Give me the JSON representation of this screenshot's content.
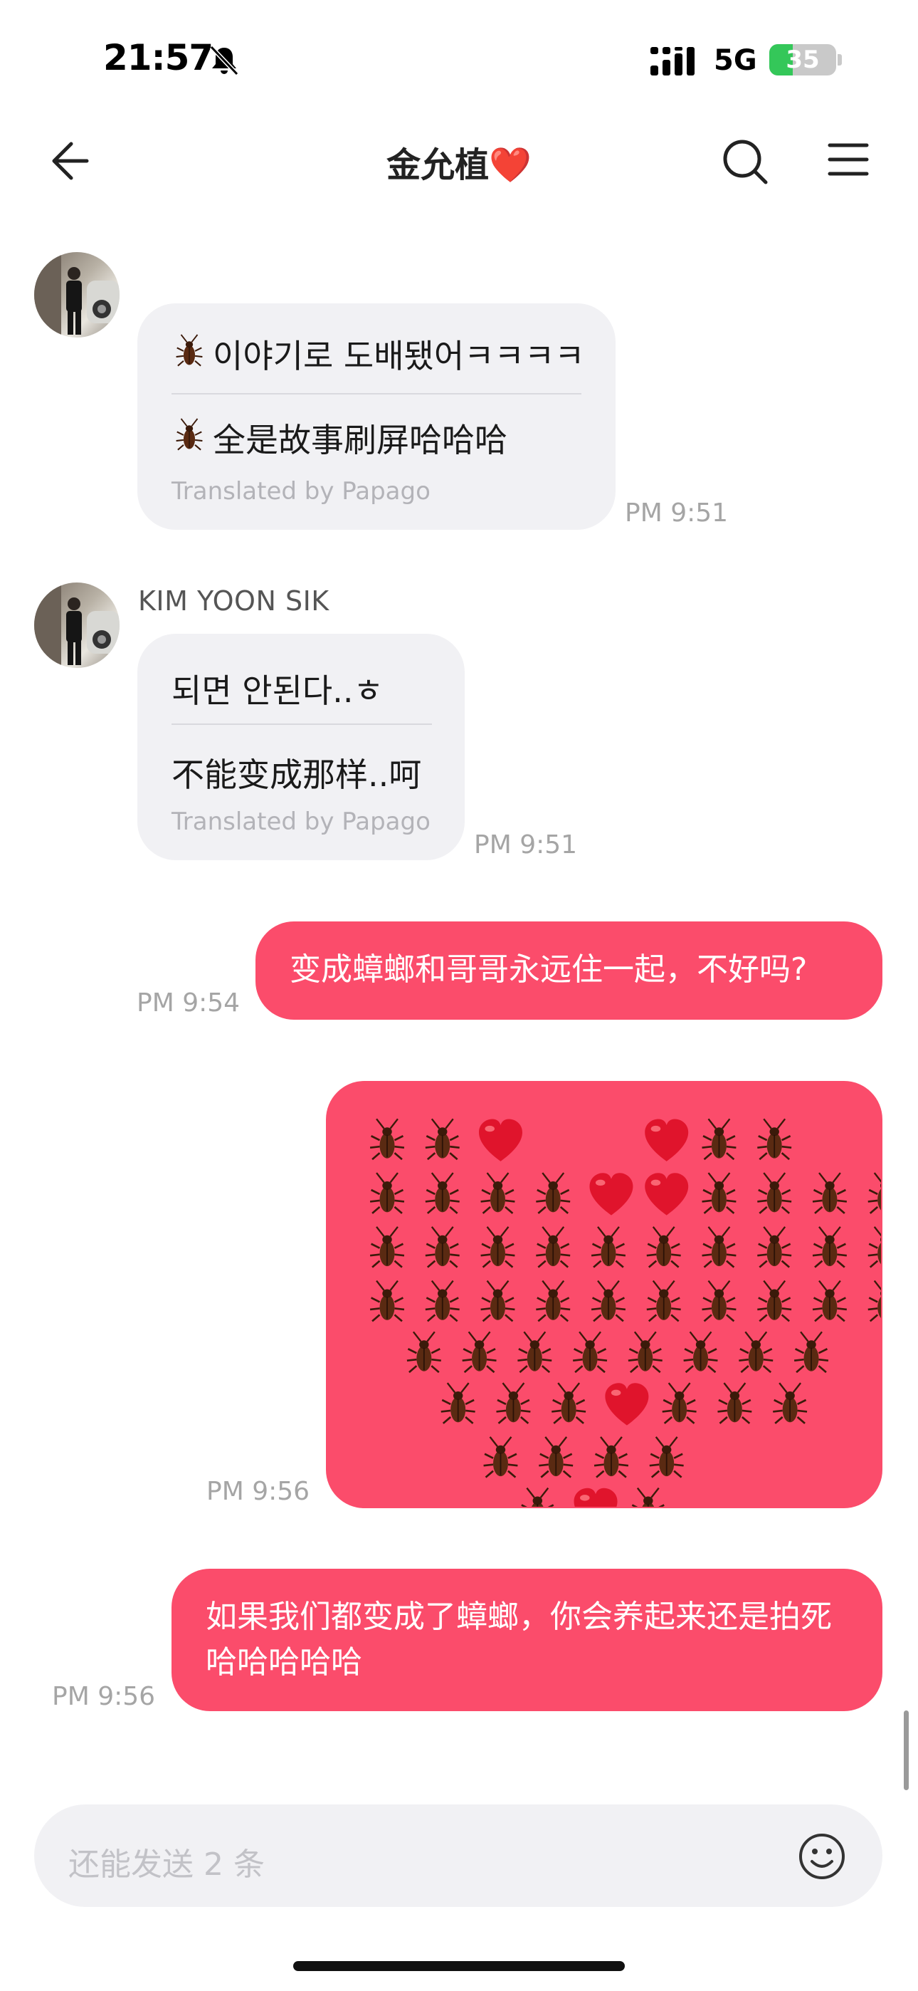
{
  "status_bar": {
    "time": "21:57",
    "network": "5G",
    "battery": "35",
    "battery_level": 0.35
  },
  "header": {
    "title": "金允植❤️"
  },
  "messages": [
    {
      "sender": "",
      "original": "이야기로 도배됐어ㅋㅋㅋㅋ",
      "translation": "全是故事刷屏哈哈哈",
      "translated_by": "Translated by Papago",
      "time": "PM 9:51"
    },
    {
      "sender": "KIM YOON SIK",
      "original": "되면 안된다..ㅎ",
      "translation": "不能变成那样..呵",
      "translated_by": "Translated by Papago",
      "time": "PM 9:51"
    },
    {
      "text": "变成蟑螂和哥哥永远住一起，不好吗?",
      "time": "PM 9:54"
    },
    {
      "art": "cockroach-heart-art",
      "time": "PM 9:56"
    },
    {
      "text": "如果我们都变成了蟑螂，你会养起来还是拍死哈哈哈哈哈",
      "time": "PM 9:56"
    }
  ],
  "input": {
    "placeholder": "还能发送 2 条"
  },
  "colors": {
    "outgoing_bubble": "#fb4c6b",
    "incoming_bubble": "#f1f1f4",
    "battery_green": "#34c759"
  },
  "icons": [
    "back-arrow-icon",
    "search-icon",
    "menu-icon",
    "bell-slash-icon",
    "signal-icon",
    "emoji-icon",
    "cockroach-icon",
    "heart-icon"
  ]
}
